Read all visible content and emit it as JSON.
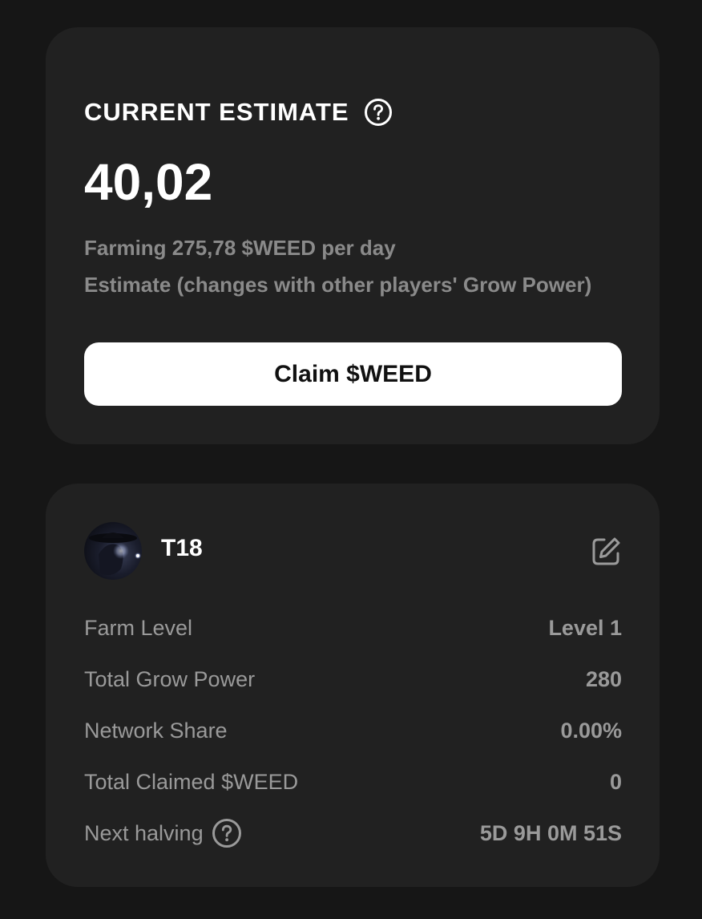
{
  "estimate": {
    "title": "CURRENT ESTIMATE",
    "value": "40,02",
    "farming_line": "Farming 275,78 $WEED per day",
    "note_line": "Estimate (changes with other players' Grow Power)",
    "claim_label": "Claim $WEED",
    "help_icon": "question-circle-icon"
  },
  "profile": {
    "username": "T18",
    "edit_icon": "edit-icon",
    "stats": [
      {
        "label": "Farm Level",
        "value": "Level 1"
      },
      {
        "label": "Total Grow Power",
        "value": "280"
      },
      {
        "label": "Network Share",
        "value": "0.00%"
      },
      {
        "label": "Total Claimed $WEED",
        "value": "0"
      },
      {
        "label": "Next halving",
        "value": "5D 9H 0M 51S"
      }
    ]
  },
  "colors": {
    "background": "#161616",
    "card": "#212121",
    "text_primary": "#ffffff",
    "text_muted": "#8a8a8a",
    "button_bg": "#ffffff"
  }
}
